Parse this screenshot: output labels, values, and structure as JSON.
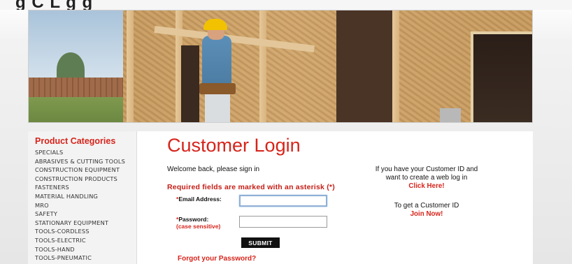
{
  "header": {
    "title_fragment": "g    C          L   g  g  "
  },
  "sidebar": {
    "heading": "Product Categories",
    "items": [
      "SPECIALS",
      "ABRASIVES & CUTTING TOOLS",
      "CONSTRUCTION EQUIPMENT",
      "CONSTRUCTION PRODUCTS",
      "FASTENERS",
      "MATERIAL HANDLING",
      "MRO",
      "SAFETY",
      "STATIONARY EQUIPMENT",
      "TOOLS-CORDLESS",
      "TOOLS-ELECTRIC",
      "TOOLS-HAND",
      "TOOLS-PNEUMATIC"
    ]
  },
  "login": {
    "title": "Customer Login",
    "welcome": "Welcome back, please sign in",
    "required_note": "Required fields are marked with an asterisk (*)",
    "asterisk": "*",
    "email_label": "Email Address:",
    "email_value": "",
    "password_label": "Password:",
    "password_sub": "(case sensitive)",
    "password_value": "",
    "submit_label": "SUBMIT",
    "forgot_label": "Forgot your Password?"
  },
  "info": {
    "weblog_text_1": "If you have your Customer ID and",
    "weblog_text_2": "want to create a web log in",
    "click_here": "Click Here!",
    "get_id_text": "To get a Customer ID",
    "join_now": "Join Now!"
  },
  "colors": {
    "accent": "#d6241b",
    "button": "#111111"
  }
}
